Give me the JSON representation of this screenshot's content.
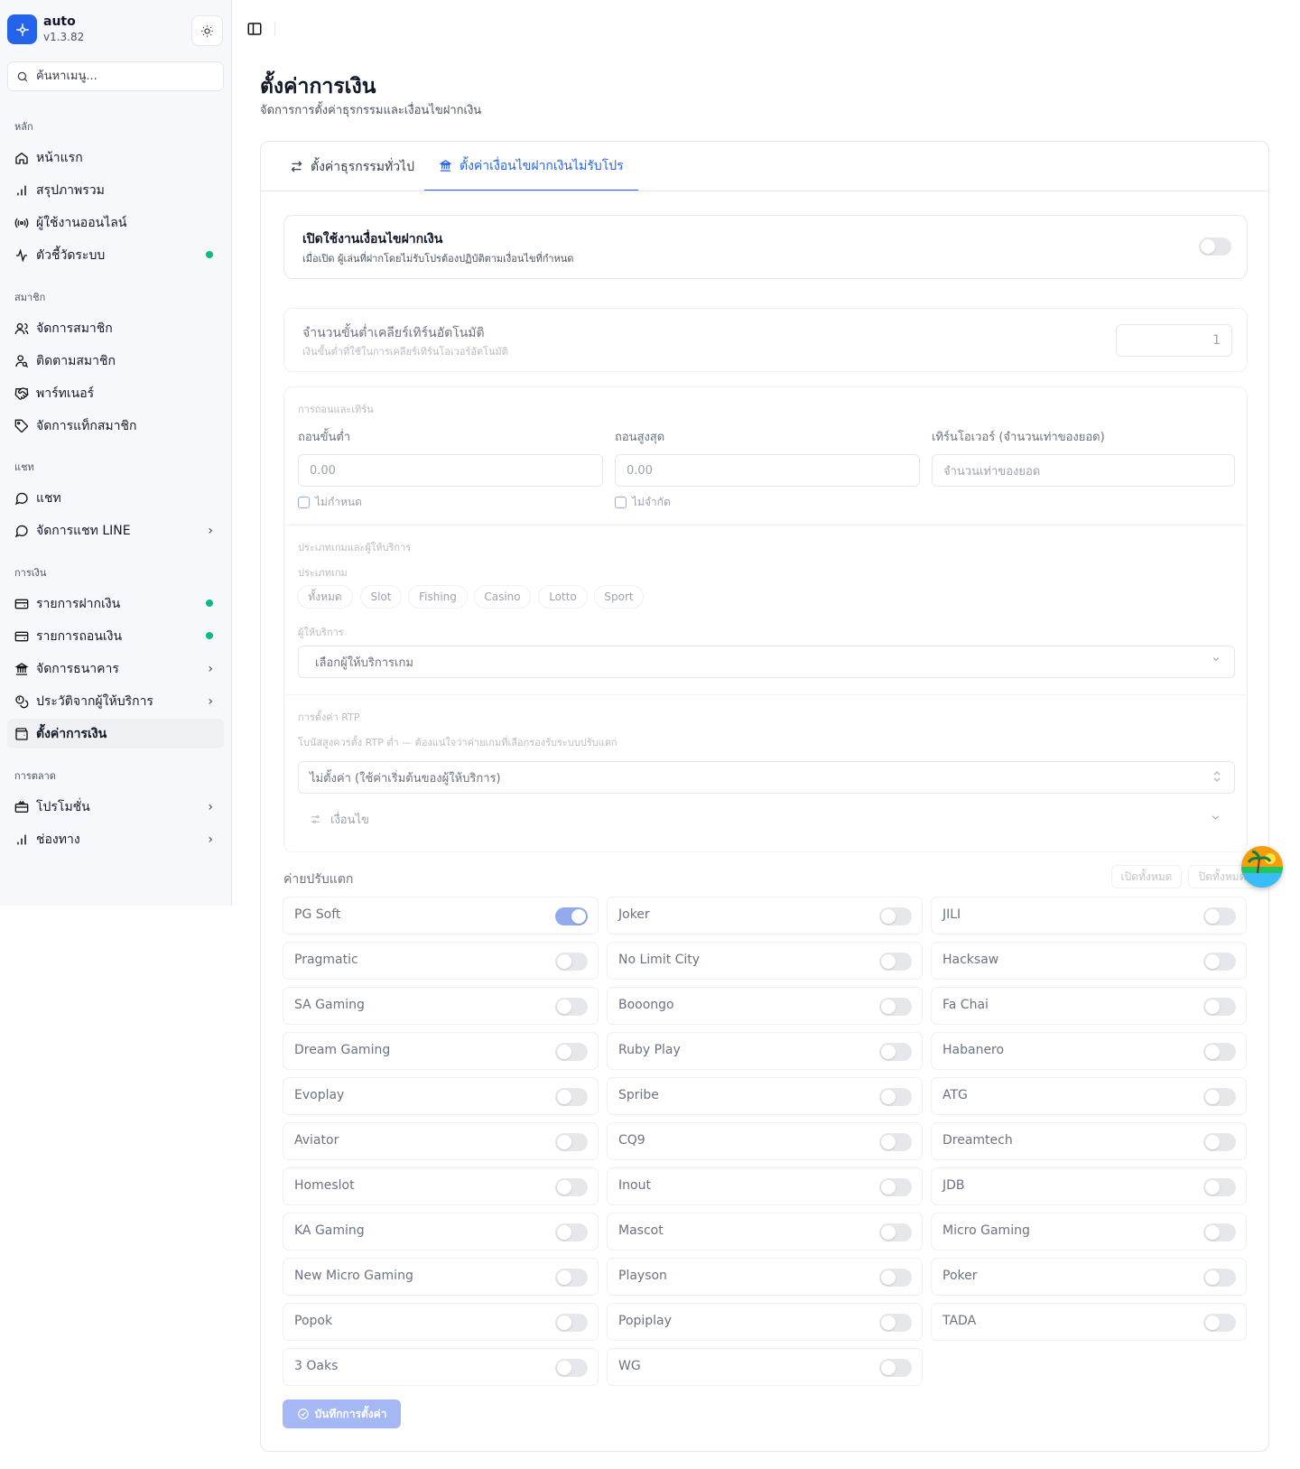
{
  "app": {
    "name": "auto",
    "version": "v1.3.82"
  },
  "search": {
    "placeholder": "ค้นหาเมนู..."
  },
  "sidebar": {
    "sections": [
      {
        "title": "หลัก",
        "items": [
          "หน้าแรก",
          "สรุปภาพรวม",
          "ผู้ใช้งานออนไลน์",
          "ตัวชี้วัดระบบ"
        ]
      },
      {
        "title": "สมาชิก",
        "items": [
          "จัดการสมาชิก",
          "ติดตามสมาชิก",
          "พาร์ทเนอร์",
          "จัดการแท็กสมาชิก"
        ]
      },
      {
        "title": "แชท",
        "items": [
          "แชท",
          "จัดการแชท LINE"
        ]
      },
      {
        "title": "การเงิน",
        "items": [
          "รายการฝากเงิน",
          "รายการถอนเงิน",
          "จัดการธนาคาร",
          "ประวัติจากผู้ให้บริการ",
          "ตั้งค่าการเงิน"
        ]
      },
      {
        "title": "การตลาด",
        "items": [
          "โปรโมชั่น",
          "ช่องทาง"
        ]
      }
    ]
  },
  "page": {
    "title": "ตั้งค่าการเงิน",
    "subtitle": "จัดการการตั้งค่าธุรกรรมและเงื่อนไขฝากเงิน"
  },
  "tabs": [
    "ตั้งค่าธุรกรรมทั่วไป",
    "ตั้งค่าเงื่อนไขฝากเงินไม่รับโปร"
  ],
  "enable": {
    "title": "เปิดใช้งานเงื่อนไขฝากเงิน",
    "desc": "เมื่อเปิด ผู้เล่นที่ฝากโดยไม่รับโปรต้องปฏิบัติตามเงื่อนไขที่กำหนด",
    "on": false
  },
  "min_clear": {
    "title": "จำนวนขั้นต่ำเคลียร์เทิร์นอัตโนมัติ",
    "desc": "เงินขั้นต่ำที่ใช้ในการเคลียร์เทิร์นโอเวอร์อัตโนมัติ",
    "value": "1"
  },
  "withdraw": {
    "section": "การถอนและเทิร์น",
    "min_label": "ถอนขั้นต่ำ",
    "min_placeholder": "0.00",
    "min_check": "ไม่กำหนด",
    "max_label": "ถอนสูงสุด",
    "max_placeholder": "0.00",
    "max_check": "ไม่จำกัด",
    "turn_label": "เทิร์นโอเวอร์ (จำนวนเท่าของยอด)",
    "turn_placeholder": "จำนวนเท่าของยอด"
  },
  "game": {
    "section": "ประเภทเกมและผู้ให้บริการ",
    "type_label": "ประเภทเกม",
    "types": [
      "ทั้งหมด",
      "Slot",
      "Fishing",
      "Casino",
      "Lotto",
      "Sport"
    ],
    "provider_label": "ผู้ให้บริการ",
    "provider_placeholder": "เลือกผู้ให้บริการเกม"
  },
  "rtp": {
    "section": "การตั้งค่า RTP",
    "desc": "โบนัสสูงควรตั้ง RTP ต่ำ — ต้องแน่ใจว่าค่ายเกมที่เลือกรองรับระบบปรับแตก",
    "select": "ไม่ตั้งค่า (ใช้ค่าเริ่มต้นของผู้ให้บริการ)",
    "conditions": "เงื่อนไข"
  },
  "providers": {
    "title": "ค่ายปรับแตก",
    "enable_all": "เปิดทั้งหมด",
    "disable_all": "ปิดทั้งหมด",
    "items": [
      {
        "name": "PG Soft",
        "on": true
      },
      {
        "name": "Joker",
        "on": false
      },
      {
        "name": "JILI",
        "on": false
      },
      {
        "name": "Pragmatic",
        "on": false
      },
      {
        "name": "No Limit City",
        "on": false
      },
      {
        "name": "Hacksaw",
        "on": false
      },
      {
        "name": "SA Gaming",
        "on": false
      },
      {
        "name": "Booongo",
        "on": false
      },
      {
        "name": "Fa Chai",
        "on": false
      },
      {
        "name": "Dream Gaming",
        "on": false
      },
      {
        "name": "Ruby Play",
        "on": false
      },
      {
        "name": "Habanero",
        "on": false
      },
      {
        "name": "Evoplay",
        "on": false
      },
      {
        "name": "Spribe",
        "on": false
      },
      {
        "name": "ATG",
        "on": false
      },
      {
        "name": "Aviator",
        "on": false
      },
      {
        "name": "CQ9",
        "on": false
      },
      {
        "name": "Dreamtech",
        "on": false
      },
      {
        "name": "Homeslot",
        "on": false
      },
      {
        "name": "Inout",
        "on": false
      },
      {
        "name": "JDB",
        "on": false
      },
      {
        "name": "KA Gaming",
        "on": false
      },
      {
        "name": "Mascot",
        "on": false
      },
      {
        "name": "Micro Gaming",
        "on": false
      },
      {
        "name": "New Micro Gaming",
        "on": false
      },
      {
        "name": "Playson",
        "on": false
      },
      {
        "name": "Poker",
        "on": false
      },
      {
        "name": "Popok",
        "on": false
      },
      {
        "name": "Popiplay",
        "on": false
      },
      {
        "name": "TADA",
        "on": false
      },
      {
        "name": "3 Oaks",
        "on": false
      },
      {
        "name": "WG",
        "on": false
      }
    ]
  },
  "save_label": "บันทึกการตั้งค่า"
}
